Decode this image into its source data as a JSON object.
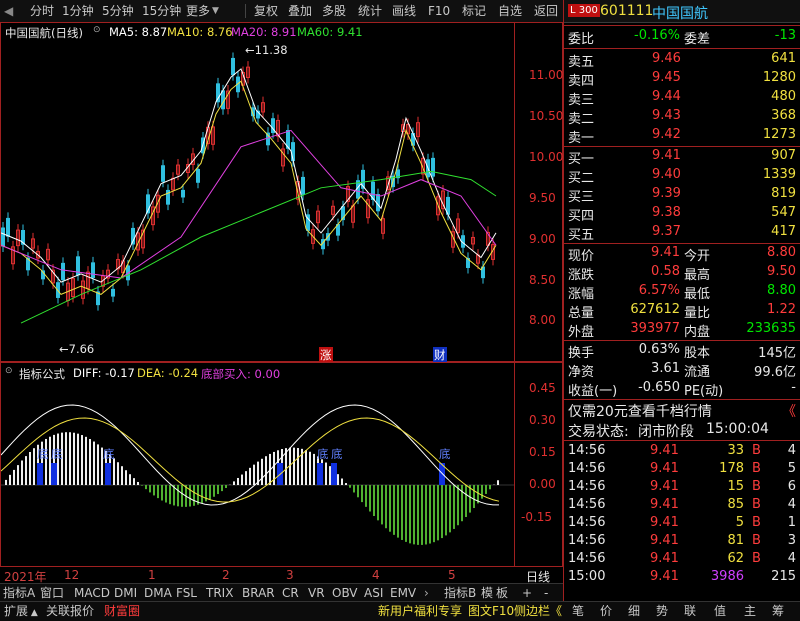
{
  "toolbar": {
    "items": [
      "分时",
      "1分钟",
      "5分钟",
      "15分钟",
      "更多",
      "复权",
      "叠加",
      "多股",
      "统计",
      "画线",
      "F10",
      "标记",
      "自选",
      "返回"
    ]
  },
  "main_chart": {
    "title": "中国国航(日线)",
    "legend": [
      {
        "label": "MA5: 8.87",
        "color": "#ffffff"
      },
      {
        "label": "MA10: 8.76",
        "color": "#f0e040"
      },
      {
        "label": "MA20: 8.91",
        "color": "#e040e0"
      },
      {
        "label": "MA60: 9.41",
        "color": "#30e030"
      }
    ],
    "price_ticks": [
      "11.00",
      "10.50",
      "10.00",
      "9.50",
      "9.00",
      "8.50",
      "8.00"
    ],
    "high_label": "11.38",
    "low_label": "7.66",
    "markers": [
      "涨",
      "财"
    ]
  },
  "indicator_chart": {
    "title": "指标公式",
    "legend": [
      {
        "label": "DIFF: -0.17",
        "color": "#ffffff"
      },
      {
        "label": "DEA: -0.24",
        "color": "#f0e040"
      },
      {
        "label": "底部买入: 0.00",
        "color": "#e040e0"
      }
    ],
    "ticks": [
      "0.45",
      "0.30",
      "0.15",
      "0.00",
      "-0.15"
    ],
    "tags": [
      "底",
      "底",
      "底",
      "底",
      "底",
      "底"
    ]
  },
  "date_strip": {
    "labels": [
      "2021年",
      "12",
      "1",
      "2",
      "3",
      "4",
      "5"
    ],
    "right": "日线"
  },
  "tabs": {
    "items": [
      "指标A",
      "窗口",
      "MACD",
      "DMI",
      "DMA",
      "FSL",
      "TRIX",
      "BRAR",
      "CR",
      "VR",
      "OBV",
      "ASI",
      "EMV"
    ],
    "extra": [
      "指标B",
      "模",
      "板",
      "+",
      "-"
    ]
  },
  "bottom": {
    "left": [
      "扩展",
      "关联报价",
      "财富圈"
    ],
    "middle": "新用户福利专享",
    "middle2": "图文F10",
    "middle3": "侧边栏《",
    "right": [
      "笔",
      "价",
      "细",
      "势",
      "联",
      "值",
      "主",
      "筹"
    ]
  },
  "panel": {
    "code": "601111",
    "name": "中国国航",
    "badge": "L 300",
    "weibi_label": "委比",
    "weibi": "-0.16%",
    "weicha_label": "委差",
    "weicha": "-13",
    "asks": [
      {
        "label": "卖五",
        "price": "9.46",
        "vol": "641"
      },
      {
        "label": "卖四",
        "price": "9.45",
        "vol": "1280"
      },
      {
        "label": "卖三",
        "price": "9.44",
        "vol": "480"
      },
      {
        "label": "卖二",
        "price": "9.43",
        "vol": "368"
      },
      {
        "label": "卖一",
        "price": "9.42",
        "vol": "1273"
      }
    ],
    "bids": [
      {
        "label": "买一",
        "price": "9.41",
        "vol": "907"
      },
      {
        "label": "买二",
        "price": "9.40",
        "vol": "1339"
      },
      {
        "label": "买三",
        "price": "9.39",
        "vol": "819"
      },
      {
        "label": "买四",
        "price": "9.38",
        "vol": "547"
      },
      {
        "label": "买五",
        "price": "9.37",
        "vol": "417"
      }
    ],
    "stats": [
      {
        "l1": "现价",
        "v1": "9.41",
        "l2": "今开",
        "v2": "8.80"
      },
      {
        "l1": "涨跌",
        "v1": "0.58",
        "l2": "最高",
        "v2": "9.50"
      },
      {
        "l1": "涨幅",
        "v1": "6.57%",
        "l2": "最低",
        "v2": "8.80"
      },
      {
        "l1": "总量",
        "v1": "627612",
        "l2": "量比",
        "v2": "1.22"
      },
      {
        "l1": "外盘",
        "v1": "393977",
        "l2": "内盘",
        "v2": "233635"
      }
    ],
    "stats2": [
      {
        "l1": "换手",
        "v1": "0.63%",
        "l2": "股本",
        "v2": "145亿"
      },
      {
        "l1": "净资",
        "v1": "3.61",
        "l2": "流通",
        "v2": "99.6亿"
      },
      {
        "l1": "收益(一)",
        "v1": "-0.650",
        "l2": "PE(动)",
        "v2": "-"
      }
    ],
    "promo": "仅需20元查看千档行情",
    "promo_arrows": "《",
    "trade_status_label": "交易状态:",
    "trade_status": "闭市阶段",
    "trade_time": "15:00:04",
    "ticks": [
      {
        "time": "14:56",
        "price": "9.41",
        "vol": "33",
        "bs": "B",
        "n": "4"
      },
      {
        "time": "14:56",
        "price": "9.41",
        "vol": "178",
        "bs": "B",
        "n": "5"
      },
      {
        "time": "14:56",
        "price": "9.41",
        "vol": "15",
        "bs": "B",
        "n": "6"
      },
      {
        "time": "14:56",
        "price": "9.41",
        "vol": "85",
        "bs": "B",
        "n": "4"
      },
      {
        "time": "14:56",
        "price": "9.41",
        "vol": "5",
        "bs": "B",
        "n": "1"
      },
      {
        "time": "14:56",
        "price": "9.41",
        "vol": "81",
        "bs": "B",
        "n": "3"
      },
      {
        "time": "14:56",
        "price": "9.41",
        "vol": "62",
        "bs": "B",
        "n": "4"
      },
      {
        "time": "15:00",
        "price": "9.41",
        "vol": "3986",
        "bs": "",
        "n": "215"
      }
    ]
  }
}
